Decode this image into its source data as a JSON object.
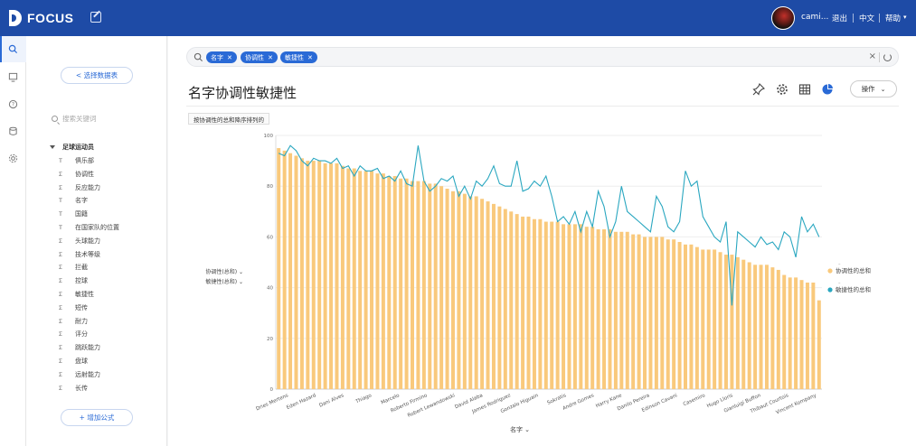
{
  "header": {
    "brand": "FOCUS",
    "user": "cami...",
    "links": [
      "退出",
      "中文",
      "帮助"
    ]
  },
  "sidebar": {
    "select_table": "< 选择数据表",
    "search_placeholder": "搜索关键词",
    "root": "足球运动员",
    "fields": [
      {
        "type": "T",
        "label": "俱乐部"
      },
      {
        "type": "Σ",
        "label": "协调性"
      },
      {
        "type": "Σ",
        "label": "反应能力"
      },
      {
        "type": "T",
        "label": "名字"
      },
      {
        "type": "T",
        "label": "国籍"
      },
      {
        "type": "T",
        "label": "在国家队的位置"
      },
      {
        "type": "Σ",
        "label": "头球能力"
      },
      {
        "type": "Σ",
        "label": "技术等级"
      },
      {
        "type": "Σ",
        "label": "拦截"
      },
      {
        "type": "Σ",
        "label": "控球"
      },
      {
        "type": "Σ",
        "label": "敏捷性"
      },
      {
        "type": "Σ",
        "label": "短传"
      },
      {
        "type": "Σ",
        "label": "耐力"
      },
      {
        "type": "Σ",
        "label": "评分"
      },
      {
        "type": "Σ",
        "label": "跳跃能力"
      },
      {
        "type": "Σ",
        "label": "盘球"
      },
      {
        "type": "Σ",
        "label": "远射能力"
      },
      {
        "type": "Σ",
        "label": "长传"
      }
    ],
    "add_formula": "+ 增加公式"
  },
  "search": {
    "tags": [
      "名字",
      "协调性",
      "敏捷性"
    ],
    "clear": "×"
  },
  "main": {
    "title": "名字协调性敏捷性",
    "ops_label": "操作",
    "sort_chip": "按协调性的总和降序排列的"
  },
  "chart_data": {
    "type": "bar+line",
    "xlabel": "名字",
    "ylim": [
      0,
      100
    ],
    "yticks": [
      0,
      20,
      40,
      60,
      80,
      100
    ],
    "y_series_selectors": [
      "协调性(总和)",
      "敏捷性(总和)"
    ],
    "legend_position": "right",
    "series": [
      {
        "name": "协调性的总和",
        "type": "bar",
        "color": "#f9c97c",
        "values": [
          95,
          94,
          93,
          92,
          91,
          90,
          90,
          90,
          89,
          89,
          89,
          88,
          87,
          87,
          86,
          86,
          86,
          85,
          85,
          84,
          84,
          83,
          83,
          82,
          82,
          82,
          81,
          81,
          80,
          79,
          78,
          78,
          77,
          76,
          76,
          75,
          74,
          73,
          72,
          71,
          70,
          69,
          68,
          68,
          67,
          67,
          66,
          66,
          66,
          65,
          65,
          65,
          65,
          64,
          64,
          63,
          63,
          63,
          62,
          62,
          62,
          61,
          61,
          60,
          60,
          60,
          60,
          59,
          59,
          58,
          57,
          57,
          56,
          55,
          55,
          55,
          54,
          53,
          53,
          52,
          51,
          50,
          49,
          49,
          49,
          48,
          47,
          45,
          44,
          44,
          43,
          42,
          42,
          35
        ]
      },
      {
        "name": "敏捷性的总和",
        "type": "line",
        "color": "#2aa7c0",
        "values": [
          93,
          92,
          96,
          94,
          90,
          88,
          91,
          90,
          90,
          89,
          91,
          87,
          88,
          84,
          88,
          86,
          86,
          87,
          83,
          84,
          82,
          86,
          81,
          80,
          96,
          82,
          78,
          80,
          83,
          82,
          84,
          76,
          80,
          75,
          82,
          80,
          83,
          88,
          81,
          80,
          80,
          90,
          78,
          79,
          82,
          80,
          84,
          76,
          66,
          68,
          65,
          70,
          62,
          70,
          64,
          78,
          72,
          60,
          66,
          80,
          70,
          68,
          66,
          64,
          62,
          76,
          72,
          64,
          62,
          66,
          86,
          80,
          82,
          68,
          64,
          60,
          58,
          66,
          33,
          62,
          60,
          58,
          56,
          60,
          57,
          58,
          55,
          62,
          60,
          52,
          68,
          62,
          65,
          60
        ]
      }
    ],
    "x_tick_labels": [
      "Dries Mertens",
      "Eden Hazard",
      "Dani Alves",
      "Thiago",
      "Marcelo",
      "Roberto Firmino",
      "Robert Lewandowski",
      "David Alaba",
      "James Rodriguez",
      "Gonzalo Higuain",
      "Sokratis",
      "Andre Gomes",
      "Harry Kane",
      "Danilo Pereira",
      "Edinson Cavani",
      "Casemiro",
      "Hugo Lloris",
      "Gianluigi Buffon",
      "Thibaut Courtois",
      "Vincent Kompany"
    ]
  }
}
